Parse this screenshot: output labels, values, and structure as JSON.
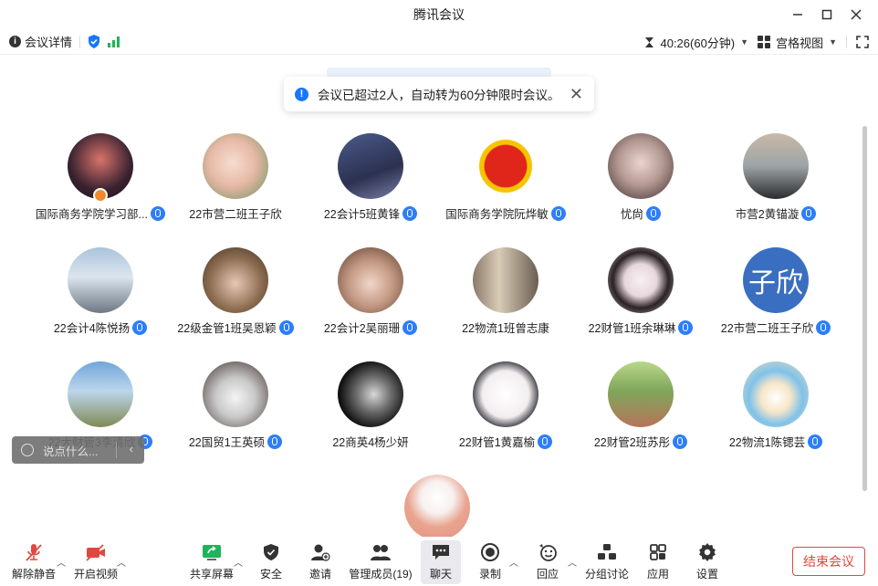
{
  "window": {
    "title": "腾讯会议"
  },
  "infobar": {
    "meeting_details": "会议详情",
    "timer": "40:26(60分钟)",
    "view_mode": "宫格视图"
  },
  "notice": {
    "text": "会议已超过2人，自动转为60分钟限时会议。"
  },
  "participants": [
    {
      "name": "国际商务学院学习部...",
      "mic": true,
      "host": true
    },
    {
      "name": "22市营二班王子欣",
      "mic": false
    },
    {
      "name": "22会计5班黄锋",
      "mic": true
    },
    {
      "name": "国际商务学院阮烨敏",
      "mic": true
    },
    {
      "name": "忧尙",
      "mic": true
    },
    {
      "name": "市营2黄锚漩",
      "mic": true
    },
    {
      "name": "22会计4陈悦扬",
      "mic": true
    },
    {
      "name": "22级金管1班吴恩颖",
      "mic": true
    },
    {
      "name": "22会计2吴丽珊",
      "mic": true
    },
    {
      "name": "22物流1班曾志康",
      "mic": false
    },
    {
      "name": "22财管1班余琳琳",
      "mic": true
    },
    {
      "name": "22市营二班王子欣",
      "mic": true,
      "letters": "子欣"
    },
    {
      "name": "22大财管3李清欣",
      "mic": true
    },
    {
      "name": "22国贸1王英硕",
      "mic": true
    },
    {
      "name": "22商英4杨少妍",
      "mic": false
    },
    {
      "name": "22财管1黄嘉榆",
      "mic": true
    },
    {
      "name": "22财管2班苏彤",
      "mic": true
    },
    {
      "name": "22物流1陈锶芸",
      "mic": true
    }
  ],
  "chat_input": {
    "placeholder": "说点什么..."
  },
  "toolbar": {
    "unmute": "解除静音",
    "start_video": "开启视频",
    "share_screen": "共享屏幕",
    "security": "安全",
    "invite": "邀请",
    "manage_members": "管理成员(19)",
    "chat": "聊天",
    "record": "录制",
    "reactions": "回应",
    "breakout": "分组讨论",
    "apps": "应用",
    "settings": "设置",
    "end_meeting": "结束会议"
  },
  "colors": {
    "accent": "#2d7ef7",
    "danger": "#e0483f",
    "signal": "#1fb35a"
  }
}
